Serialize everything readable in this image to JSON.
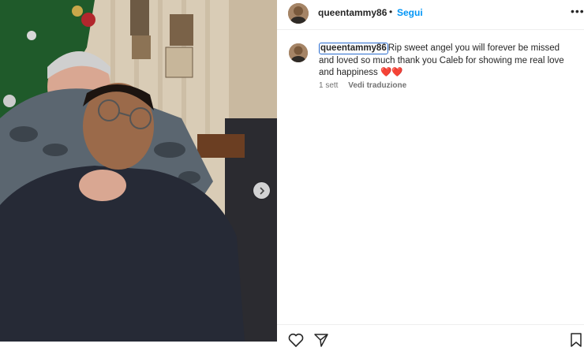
{
  "post": {
    "username": "queentammy86",
    "separator": "•",
    "follow_label": "Segui",
    "more_label": "•••"
  },
  "comment": {
    "username": "queentammy86",
    "text": "Rip sweet angel you will forever be missed and loved so much thank you Caleb for showing me real love and happiness",
    "emoji": "❤️❤️",
    "time": "1 sett",
    "translate_label": "Vedi traduzione"
  },
  "icons": {
    "next": "chevron-right-icon",
    "like": "heart-icon",
    "share": "paper-plane-icon",
    "save": "bookmark-icon",
    "more": "more-horizontal-icon"
  },
  "colors": {
    "link_blue": "#0095f6",
    "focus_outline": "#2a6ccf",
    "meta_gray": "#737373"
  }
}
